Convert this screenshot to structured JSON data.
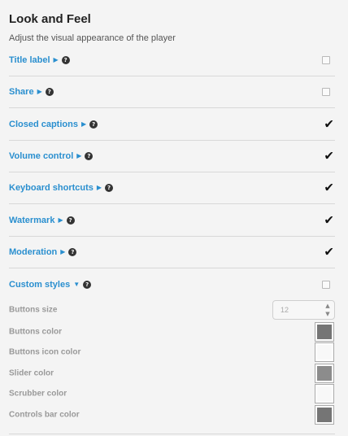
{
  "header": {
    "title": "Look and Feel",
    "subtitle": "Adjust the visual appearance of the player"
  },
  "options": [
    {
      "label": "Title label",
      "arrow": "▶",
      "checked": false
    },
    {
      "label": "Share",
      "arrow": "▶",
      "checked": false
    },
    {
      "label": "Closed captions",
      "arrow": "▶",
      "checked": true
    },
    {
      "label": "Volume control",
      "arrow": "▶",
      "checked": true
    },
    {
      "label": "Keyboard shortcuts",
      "arrow": "▶",
      "checked": true
    },
    {
      "label": "Watermark",
      "arrow": "▶",
      "checked": true
    },
    {
      "label": "Moderation",
      "arrow": "▶",
      "checked": true
    },
    {
      "label": "Custom styles",
      "arrow": "▼",
      "checked": false
    }
  ],
  "help_icon": "?",
  "custom_styles": {
    "buttons_size": {
      "label": "Buttons size",
      "value": "12",
      "up": "▲",
      "down": "▼"
    },
    "colors": [
      {
        "label": "Buttons color",
        "color": "#757575"
      },
      {
        "label": "Buttons icon color",
        "color": "#f8f8f8"
      },
      {
        "label": "Slider color",
        "color": "#8c8c8c"
      },
      {
        "label": "Scrubber color",
        "color": "#f8f8f8"
      },
      {
        "label": "Controls bar color",
        "color": "#757575"
      }
    ]
  },
  "icons": {
    "check": "✔",
    "help": "question-circle-icon",
    "expand": "triangle-right-icon",
    "collapse": "triangle-down-icon"
  }
}
